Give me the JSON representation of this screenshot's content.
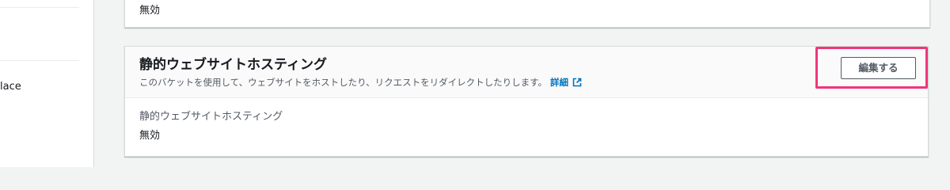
{
  "sidebar": {
    "partial_item_label": "lace"
  },
  "top_card": {
    "value": "無効"
  },
  "static_hosting_card": {
    "title": "静的ウェブサイトホスティング",
    "description": "このバケットを使用して、ウェブサイトをホストしたり、リクエストをリダイレクトしたりします。",
    "details_link_label": "詳細",
    "edit_button_label": "編集する",
    "field_label": "静的ウェブサイトホスティング",
    "field_value": "無効"
  },
  "colors": {
    "link": "#0073bb",
    "highlight": "#f0357b",
    "page_background": "#f2f3f3",
    "header_background": "#fafafa"
  },
  "icons": {
    "external_link": "external-link-icon"
  }
}
